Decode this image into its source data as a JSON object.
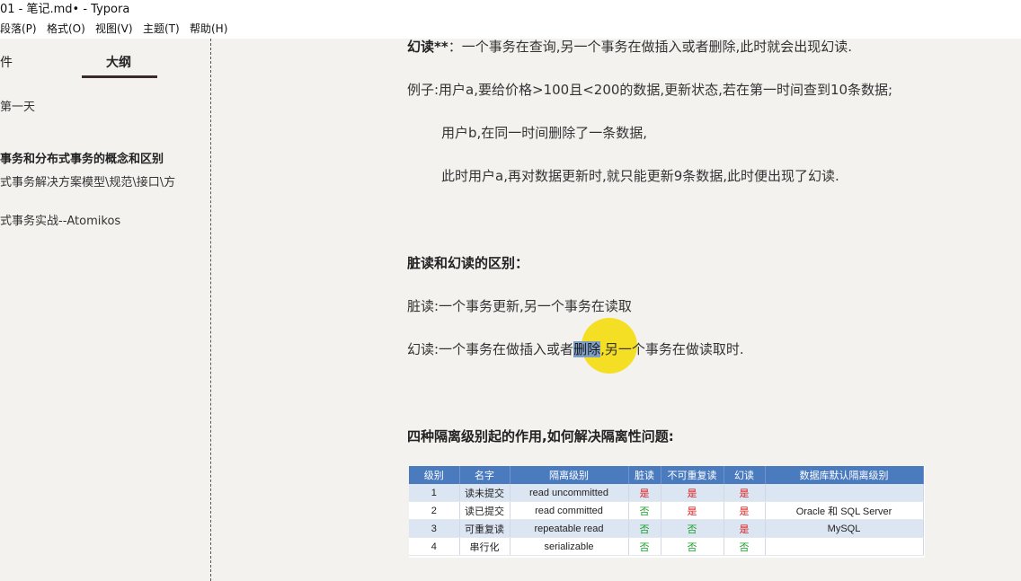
{
  "window": {
    "title": "01 - 笔记.md• - Typora"
  },
  "menu": {
    "items": [
      "段落(P)",
      "格式(O)",
      "视图(V)",
      "主题(T)",
      "帮助(H)"
    ]
  },
  "sidebar": {
    "tabs": [
      "件",
      "大纲"
    ],
    "outline": [
      "第一天",
      "事务和分布式事务的概念和区别",
      "式事务解决方案模型\\规范\\接口\\方",
      "式事务实战--Atomikos"
    ]
  },
  "doc": {
    "p1_label": "幻读**",
    "p1_text": "：一个事务在查询,另一个事务在做插入或者删除,此时就会出现幻读.",
    "p2": "例子:用户a,要给价格>100且<200的数据,更新状态,若在第一时间查到10条数据;",
    "p3": "用户b,在同一时间删除了一条数据,",
    "p4": "此时用户a,再对数据更新时,就只能更新9条数据,此时便出现了幻读.",
    "h1": "脏读和幻读的区别：",
    "p5": "脏读:一个事务更新,另一个事务在读取",
    "p6_before": "幻读:一个事务在做插入或者",
    "p6_highlight": "删除",
    "p6_after": ",另一个事务在做读取时.",
    "h2": "四种隔离级别起的作用,如何解决隔离性问题:"
  },
  "table": {
    "headers": [
      "级别",
      "名字",
      "隔离级别",
      "脏读",
      "不可重复读",
      "幻读",
      "数据库默认隔离级别"
    ],
    "rows": [
      [
        "1",
        "读未提交",
        "read uncommitted",
        "是",
        "是",
        "是",
        ""
      ],
      [
        "2",
        "读已提交",
        "read committed",
        "否",
        "是",
        "是",
        "Oracle 和 SQL Server"
      ],
      [
        "3",
        "可重复读",
        "repeatable read",
        "否",
        "否",
        "是",
        "MySQL"
      ],
      [
        "4",
        "串行化",
        "serializable",
        "否",
        "否",
        "否",
        ""
      ]
    ]
  },
  "colors": {
    "yes": "#d81b1b",
    "no": "#1a9e2a",
    "header": "#4a7bbf",
    "highlight": "#7fa0c6",
    "cursor": "#f5dc00"
  }
}
